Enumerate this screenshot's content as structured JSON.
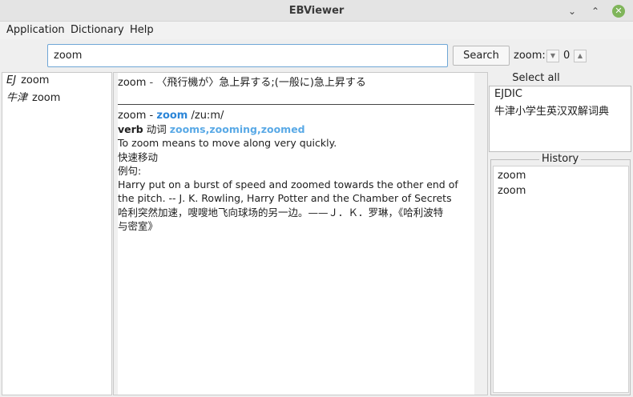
{
  "window": {
    "title": "EBViewer",
    "controls": {
      "minimize": "⌄",
      "maximize": "⌃",
      "close": "✕"
    }
  },
  "menu": {
    "items": [
      "Application",
      "Dictionary",
      "Help"
    ]
  },
  "toolbar": {
    "search_value": "zoom",
    "search_button": "Search",
    "zoom_label": "zoom:",
    "zoom_value": "0"
  },
  "results": [
    {
      "dict": "EJ",
      "word": "zoom"
    },
    {
      "dict": "牛津",
      "word": "zoom"
    }
  ],
  "entry": {
    "ej_line": {
      "word": "zoom",
      "sep": " - ",
      "definition": "〈飛行機が〉急上昇する;(一般に)急上昇する"
    },
    "oxford": {
      "word": "zoom",
      "sep": " - ",
      "headword": "zoom",
      "pron": " /zu:m/",
      "pos": "verb",
      "pos_cn": " 动词 ",
      "forms": "zooms,zooming,zoomed",
      "def_en": "To zoom means to move along very quickly.",
      "def_cn": "快速移动",
      "example_label": "例句:",
      "example_en_1": "Harry put on a burst of speed and zoomed towards the other end of",
      "example_en_2": "the pitch. -- J. K. Rowling, Harry Potter and the Chamber of Secrets",
      "example_cn_1": "哈利突然加速，嗖嗖地飞向球场的另一边。——Ｊ．Ｋ．罗琳，《哈利波特",
      "example_cn_2": "与密室》"
    }
  },
  "dictionaries": {
    "select_all": "Select all",
    "items": [
      "EJDIC",
      "牛津小学生英汉双解词典"
    ]
  },
  "history": {
    "title": "History",
    "items": [
      "zoom",
      "zoom"
    ]
  }
}
